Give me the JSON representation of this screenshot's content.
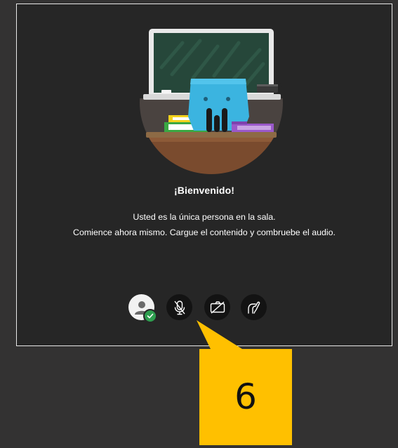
{
  "welcome": {
    "title": "¡Bienvenido!",
    "line1": "Usted es la única persona en la sala.",
    "line2": "Comience ahora mismo. Cargue el contenido y combruebe el audio."
  },
  "controls": {
    "avatar_icon": "user-avatar-icon",
    "status_icon": "check-icon",
    "mic_icon": "microphone-muted-icon",
    "camera_icon": "camera-off-icon",
    "share_icon": "share-content-icon"
  },
  "callout": {
    "number": "6",
    "color": "#ffc000"
  },
  "colors": {
    "background": "#333232",
    "panel": "#262626",
    "button": "#131313",
    "success": "#2e9e4f"
  }
}
